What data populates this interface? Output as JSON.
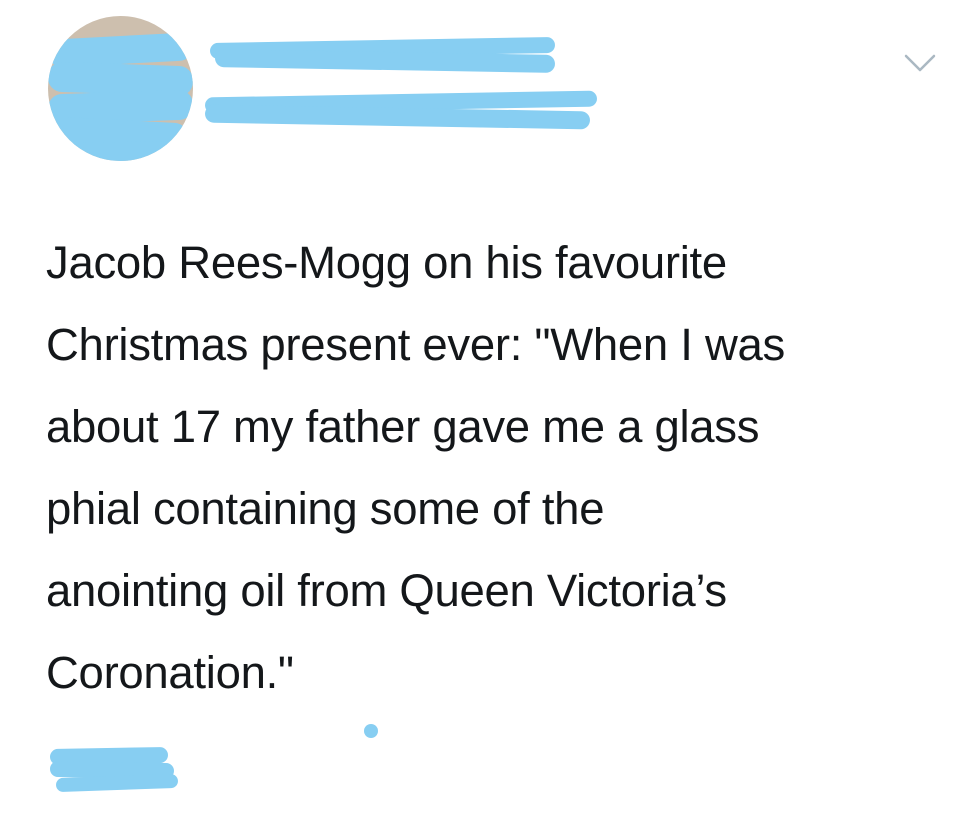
{
  "author": {
    "display_name": "",
    "handle": "",
    "redaction_color": "#87cef2"
  },
  "menu": {
    "icon": "chevron-down-icon"
  },
  "tweet": {
    "lines": [
      "Jacob Rees-Mogg on his favourite",
      "Christmas present ever: \"When I was",
      "about 17 my father gave me a glass",
      "phial containing some of the",
      "anointing oil from Queen Victoria’s",
      "Coronation.\""
    ]
  },
  "footer": {
    "timestamp": ""
  },
  "colors": {
    "text": "#14171a",
    "background": "#ffffff",
    "icon": "#aab8c2"
  }
}
